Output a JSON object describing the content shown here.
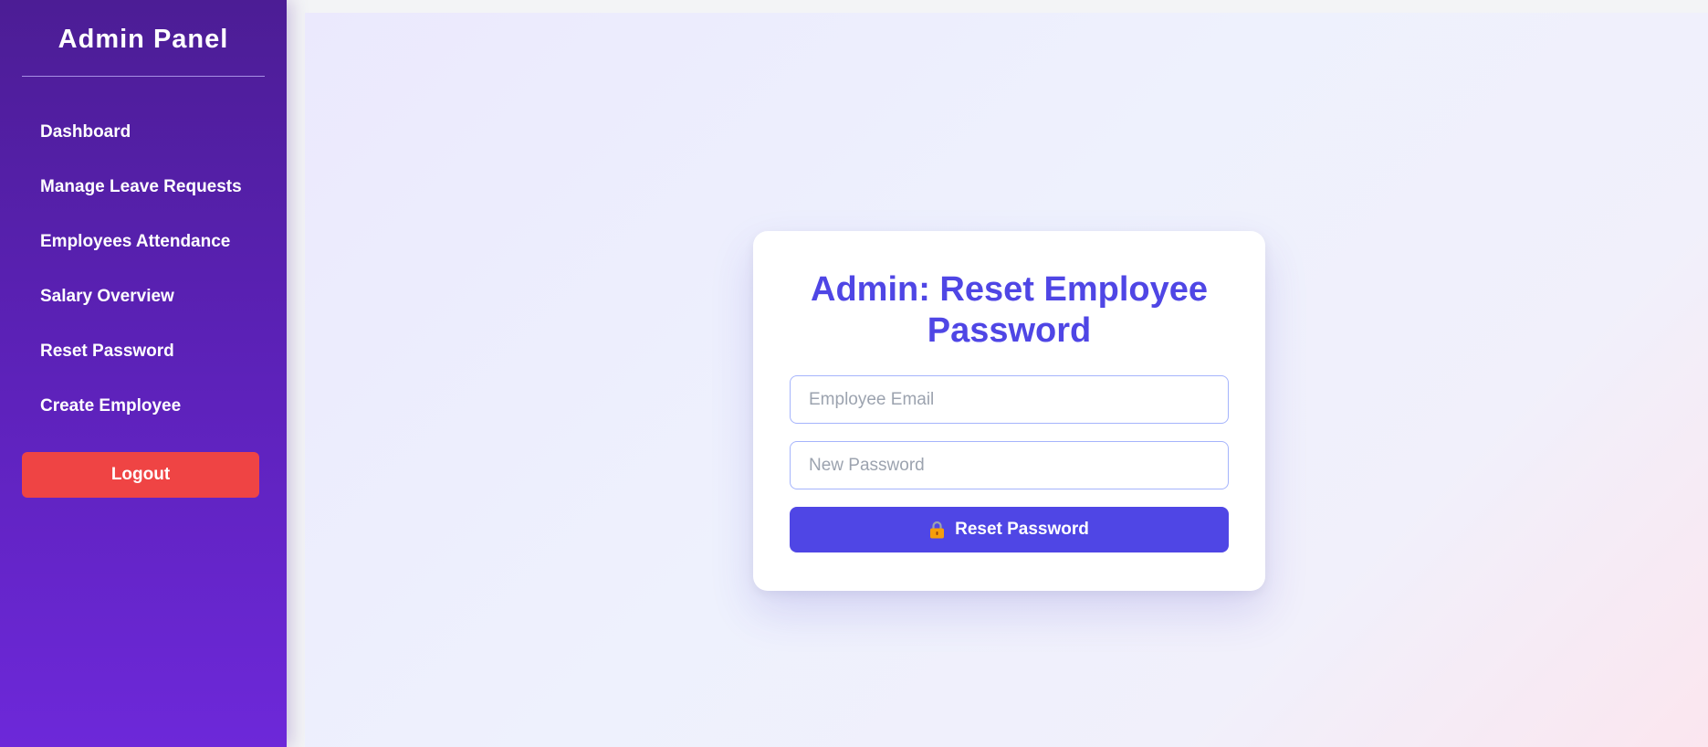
{
  "sidebar": {
    "title": "Admin Panel",
    "items": [
      {
        "label": "Dashboard"
      },
      {
        "label": "Manage Leave Requests"
      },
      {
        "label": "Employees Attendance"
      },
      {
        "label": "Salary Overview"
      },
      {
        "label": "Reset Password"
      },
      {
        "label": "Create Employee"
      }
    ],
    "logout_label": "Logout"
  },
  "form": {
    "title": "Admin: Reset Employee Password",
    "email": {
      "placeholder": "Employee Email",
      "value": ""
    },
    "password": {
      "placeholder": "New Password",
      "value": ""
    },
    "submit_label": "Reset Password",
    "submit_icon": "lock-icon"
  },
  "colors": {
    "sidebar_top": "#4c1d95",
    "sidebar_bottom": "#6d28d9",
    "accent": "#4f46e5",
    "logout": "#ef4444"
  }
}
